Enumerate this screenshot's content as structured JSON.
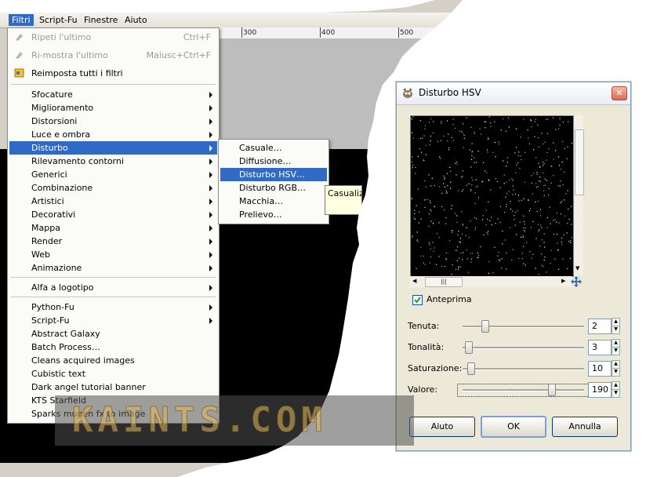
{
  "menubar": {
    "items": [
      "Filtri",
      "Script-Fu",
      "Finestre",
      "Aiuto"
    ]
  },
  "ruler": {
    "ticks": [
      "300",
      "400",
      "500"
    ]
  },
  "filtri_menu": {
    "repeat_last": "Ripeti l'ultimo",
    "repeat_last_shortcut": "Ctrl+F",
    "reshow_last": "Ri-mostra l'ultimo",
    "reshow_last_shortcut": "Maiusc+Ctrl+F",
    "reset_all": "Reimposta tutti i filtri",
    "categories": [
      "Sfocature",
      "Miglioramento",
      "Distorsioni",
      "Luce e ombra",
      "Disturbo",
      "Rilevamento contorni",
      "Generici",
      "Combinazione",
      "Artistici",
      "Decorativi",
      "Mappa",
      "Render",
      "Web",
      "Animazione"
    ],
    "alpha_to_logo": "Alfa a logotipo",
    "script_groups": [
      "Python-Fu",
      "Script-Fu"
    ],
    "scripts": [
      "Abstract Galaxy",
      "Batch Process…",
      "Cleans acquired images",
      "Cubistic text",
      "Dark angel tutorial banner",
      "KTS Starfield",
      "Sparks mugen fx to image"
    ]
  },
  "disturbo_submenu": {
    "items": [
      "Casuale…",
      "Diffusione…",
      "Disturbo HSV…",
      "Disturbo RGB…",
      "Macchia…",
      "Prelievo…"
    ]
  },
  "tooltip": "Casualizz",
  "hsv_dialog": {
    "title": "Disturbo HSV",
    "preview_label": "Anteprima",
    "preview_checked": true,
    "params": [
      {
        "label": "Tenuta:",
        "value": "2",
        "level": 0.16
      },
      {
        "label": "Tonalità:",
        "value": "3",
        "level": 0.02
      },
      {
        "label": "Saturazione:",
        "value": "10",
        "level": 0.04
      },
      {
        "label": "Valore:",
        "value": "190",
        "level": 0.74
      }
    ],
    "buttons": {
      "help": "Aiuto",
      "ok": "OK",
      "cancel": "Annulla"
    }
  },
  "watermark": "KAINTS.COM",
  "colors": {
    "selection": "#316ac5",
    "dialog_bg": "#ece9d8",
    "menu_bg": "#fbfbf8"
  }
}
